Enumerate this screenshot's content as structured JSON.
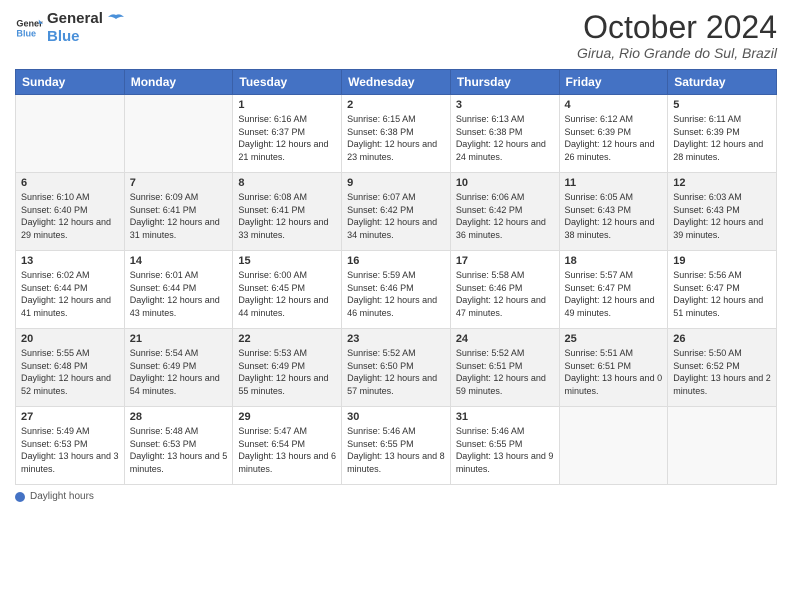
{
  "header": {
    "logo_general": "General",
    "logo_blue": "Blue",
    "month_title": "October 2024",
    "location": "Girua, Rio Grande do Sul, Brazil"
  },
  "weekdays": [
    "Sunday",
    "Monday",
    "Tuesday",
    "Wednesday",
    "Thursday",
    "Friday",
    "Saturday"
  ],
  "weeks": [
    [
      {
        "day": "",
        "sunrise": "",
        "sunset": "",
        "daylight": ""
      },
      {
        "day": "",
        "sunrise": "",
        "sunset": "",
        "daylight": ""
      },
      {
        "day": "1",
        "sunrise": "Sunrise: 6:16 AM",
        "sunset": "Sunset: 6:37 PM",
        "daylight": "Daylight: 12 hours and 21 minutes."
      },
      {
        "day": "2",
        "sunrise": "Sunrise: 6:15 AM",
        "sunset": "Sunset: 6:38 PM",
        "daylight": "Daylight: 12 hours and 23 minutes."
      },
      {
        "day": "3",
        "sunrise": "Sunrise: 6:13 AM",
        "sunset": "Sunset: 6:38 PM",
        "daylight": "Daylight: 12 hours and 24 minutes."
      },
      {
        "day": "4",
        "sunrise": "Sunrise: 6:12 AM",
        "sunset": "Sunset: 6:39 PM",
        "daylight": "Daylight: 12 hours and 26 minutes."
      },
      {
        "day": "5",
        "sunrise": "Sunrise: 6:11 AM",
        "sunset": "Sunset: 6:39 PM",
        "daylight": "Daylight: 12 hours and 28 minutes."
      }
    ],
    [
      {
        "day": "6",
        "sunrise": "Sunrise: 6:10 AM",
        "sunset": "Sunset: 6:40 PM",
        "daylight": "Daylight: 12 hours and 29 minutes."
      },
      {
        "day": "7",
        "sunrise": "Sunrise: 6:09 AM",
        "sunset": "Sunset: 6:41 PM",
        "daylight": "Daylight: 12 hours and 31 minutes."
      },
      {
        "day": "8",
        "sunrise": "Sunrise: 6:08 AM",
        "sunset": "Sunset: 6:41 PM",
        "daylight": "Daylight: 12 hours and 33 minutes."
      },
      {
        "day": "9",
        "sunrise": "Sunrise: 6:07 AM",
        "sunset": "Sunset: 6:42 PM",
        "daylight": "Daylight: 12 hours and 34 minutes."
      },
      {
        "day": "10",
        "sunrise": "Sunrise: 6:06 AM",
        "sunset": "Sunset: 6:42 PM",
        "daylight": "Daylight: 12 hours and 36 minutes."
      },
      {
        "day": "11",
        "sunrise": "Sunrise: 6:05 AM",
        "sunset": "Sunset: 6:43 PM",
        "daylight": "Daylight: 12 hours and 38 minutes."
      },
      {
        "day": "12",
        "sunrise": "Sunrise: 6:03 AM",
        "sunset": "Sunset: 6:43 PM",
        "daylight": "Daylight: 12 hours and 39 minutes."
      }
    ],
    [
      {
        "day": "13",
        "sunrise": "Sunrise: 6:02 AM",
        "sunset": "Sunset: 6:44 PM",
        "daylight": "Daylight: 12 hours and 41 minutes."
      },
      {
        "day": "14",
        "sunrise": "Sunrise: 6:01 AM",
        "sunset": "Sunset: 6:44 PM",
        "daylight": "Daylight: 12 hours and 43 minutes."
      },
      {
        "day": "15",
        "sunrise": "Sunrise: 6:00 AM",
        "sunset": "Sunset: 6:45 PM",
        "daylight": "Daylight: 12 hours and 44 minutes."
      },
      {
        "day": "16",
        "sunrise": "Sunrise: 5:59 AM",
        "sunset": "Sunset: 6:46 PM",
        "daylight": "Daylight: 12 hours and 46 minutes."
      },
      {
        "day": "17",
        "sunrise": "Sunrise: 5:58 AM",
        "sunset": "Sunset: 6:46 PM",
        "daylight": "Daylight: 12 hours and 47 minutes."
      },
      {
        "day": "18",
        "sunrise": "Sunrise: 5:57 AM",
        "sunset": "Sunset: 6:47 PM",
        "daylight": "Daylight: 12 hours and 49 minutes."
      },
      {
        "day": "19",
        "sunrise": "Sunrise: 5:56 AM",
        "sunset": "Sunset: 6:47 PM",
        "daylight": "Daylight: 12 hours and 51 minutes."
      }
    ],
    [
      {
        "day": "20",
        "sunrise": "Sunrise: 5:55 AM",
        "sunset": "Sunset: 6:48 PM",
        "daylight": "Daylight: 12 hours and 52 minutes."
      },
      {
        "day": "21",
        "sunrise": "Sunrise: 5:54 AM",
        "sunset": "Sunset: 6:49 PM",
        "daylight": "Daylight: 12 hours and 54 minutes."
      },
      {
        "day": "22",
        "sunrise": "Sunrise: 5:53 AM",
        "sunset": "Sunset: 6:49 PM",
        "daylight": "Daylight: 12 hours and 55 minutes."
      },
      {
        "day": "23",
        "sunrise": "Sunrise: 5:52 AM",
        "sunset": "Sunset: 6:50 PM",
        "daylight": "Daylight: 12 hours and 57 minutes."
      },
      {
        "day": "24",
        "sunrise": "Sunrise: 5:52 AM",
        "sunset": "Sunset: 6:51 PM",
        "daylight": "Daylight: 12 hours and 59 minutes."
      },
      {
        "day": "25",
        "sunrise": "Sunrise: 5:51 AM",
        "sunset": "Sunset: 6:51 PM",
        "daylight": "Daylight: 13 hours and 0 minutes."
      },
      {
        "day": "26",
        "sunrise": "Sunrise: 5:50 AM",
        "sunset": "Sunset: 6:52 PM",
        "daylight": "Daylight: 13 hours and 2 minutes."
      }
    ],
    [
      {
        "day": "27",
        "sunrise": "Sunrise: 5:49 AM",
        "sunset": "Sunset: 6:53 PM",
        "daylight": "Daylight: 13 hours and 3 minutes."
      },
      {
        "day": "28",
        "sunrise": "Sunrise: 5:48 AM",
        "sunset": "Sunset: 6:53 PM",
        "daylight": "Daylight: 13 hours and 5 minutes."
      },
      {
        "day": "29",
        "sunrise": "Sunrise: 5:47 AM",
        "sunset": "Sunset: 6:54 PM",
        "daylight": "Daylight: 13 hours and 6 minutes."
      },
      {
        "day": "30",
        "sunrise": "Sunrise: 5:46 AM",
        "sunset": "Sunset: 6:55 PM",
        "daylight": "Daylight: 13 hours and 8 minutes."
      },
      {
        "day": "31",
        "sunrise": "Sunrise: 5:46 AM",
        "sunset": "Sunset: 6:55 PM",
        "daylight": "Daylight: 13 hours and 9 minutes."
      },
      {
        "day": "",
        "sunrise": "",
        "sunset": "",
        "daylight": ""
      },
      {
        "day": "",
        "sunrise": "",
        "sunset": "",
        "daylight": ""
      }
    ]
  ],
  "footer": {
    "daylight_hours_label": "Daylight hours"
  }
}
